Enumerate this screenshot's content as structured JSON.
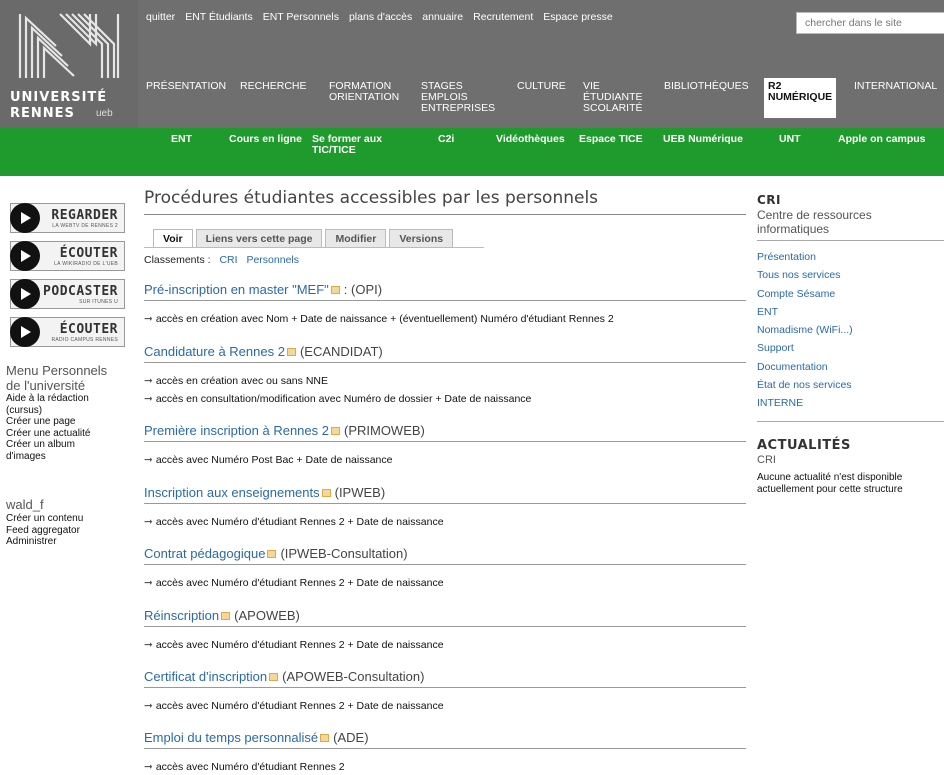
{
  "logo": {
    "line1": "UNIVERSITÉ",
    "line2": "RENNES",
    "ueb": "ueb"
  },
  "top_links": [
    "quitter",
    "ENT Étudiants",
    "ENT Personnels",
    "plans d'accès",
    "annuaire",
    "Recrutement",
    "Espace presse"
  ],
  "search": {
    "placeholder": "chercher dans le site"
  },
  "main_nav": [
    {
      "label": "PRÉSENTATION"
    },
    {
      "label": "RECHERCHE"
    },
    {
      "label": "FORMATION\nORIENTATION"
    },
    {
      "label": "STAGES\nEMPLOIS\nENTREPRISES"
    },
    {
      "label": "CULTURE"
    },
    {
      "label": "VIE\nÉTUDIANTE\nSCOLARITÉ"
    },
    {
      "label": "BIBLIOTHÈQUES"
    },
    {
      "label": "R2\nNUMÉRIQUE",
      "active": true
    },
    {
      "label": "INTERNATIONAL"
    }
  ],
  "green_bar": [
    "ENT",
    "Cours en ligne",
    "Se former aux\nTIC/TICE",
    "C2i",
    "Vidéothèques",
    "Espace TICE",
    "UEB Numérique",
    "UNT",
    "Apple on campus"
  ],
  "media": [
    {
      "label": "REGARDER",
      "sub": "LA WEBTV DE RENNES 2"
    },
    {
      "label": "ÉCOUTER",
      "sub": "LA WIKIRADIO DE L'UEB"
    },
    {
      "label": "PODCASTER",
      "sub": "SUR ITUNES U"
    },
    {
      "label": "ÉCOUTER",
      "sub": "RADIO CAMPUS RENNES"
    }
  ],
  "left_menu": {
    "heading1": "Menu Personnels",
    "heading2": "de l'université",
    "items": [
      "Aide à la rédaction",
      "(cursus)",
      "Créer une page",
      "Créer une actualité",
      "Créer un album",
      "d'images"
    ]
  },
  "user": {
    "name": "wald_f",
    "items": [
      "Créer un contenu",
      "Feed aggregator",
      "Administrer"
    ]
  },
  "page": {
    "title": "Procédures étudiantes accessibles par les personnels",
    "tabs": [
      "Voir",
      "Liens vers cette page",
      "Modifier",
      "Versions"
    ],
    "classements_label": "Classements :",
    "classements": [
      "CRI",
      "Personnels"
    ]
  },
  "sections": [
    {
      "title": "Pré-inscription en master \"MEF\"",
      "code": ": (OPI)",
      "lines": [
        "accès en création avec Nom + Date de naissance + (éventuellement) Numéro d'étudiant Rennes 2"
      ]
    },
    {
      "title": "Candidature à Rennes 2",
      "code": "(ECANDIDAT)",
      "lines": [
        "accès en création avec ou sans NNE",
        "accès en consultation/modification avec Numéro de dossier + Date de naissance"
      ]
    },
    {
      "title": "Première inscription à Rennes 2",
      "code": "(PRIMOWEB)",
      "lines": [
        "accès avec Numéro Post Bac + Date de naissance"
      ]
    },
    {
      "title": "Inscription aux enseignements",
      "code": "(IPWEB)",
      "lines": [
        "accès avec Numéro d'étudiant Rennes 2 + Date de naissance"
      ]
    },
    {
      "title": "Contrat pédagogique",
      "code": "(IPWEB-Consultation)",
      "lines": [
        "accès avec Numéro d'étudiant Rennes 2 + Date de naissance"
      ]
    },
    {
      "title": "Réinscription",
      "code": "(APOWEB)",
      "lines": [
        "accès avec Numéro d'étudiant Rennes 2 + Date de naissance"
      ]
    },
    {
      "title": "Certificat d'inscription",
      "code": "(APOWEB-Consultation)",
      "lines": [
        "accès avec Numéro d'étudiant Rennes 2 + Date de naissance"
      ]
    },
    {
      "title": "Emploi du temps personnalisé",
      "code": "(ADE)",
      "lines": [
        "accès avec Numéro d'étudiant Rennes 2"
      ]
    }
  ],
  "right": {
    "heading": "CRI",
    "subtitle1": "Centre de ressources",
    "subtitle2": "informatiques",
    "links": [
      "Présentation",
      "Tous nos services",
      "Compte Sésame",
      "ENT",
      "Nomadisme (WiFi...)",
      "Support",
      "Documentation",
      "État de nos services",
      "INTERNE"
    ]
  },
  "actus": {
    "heading": "ACTUALITÉS",
    "source": "CRI",
    "message1": "Aucune actualité n'est disponible",
    "message2": "actuellement pour cette structure"
  }
}
